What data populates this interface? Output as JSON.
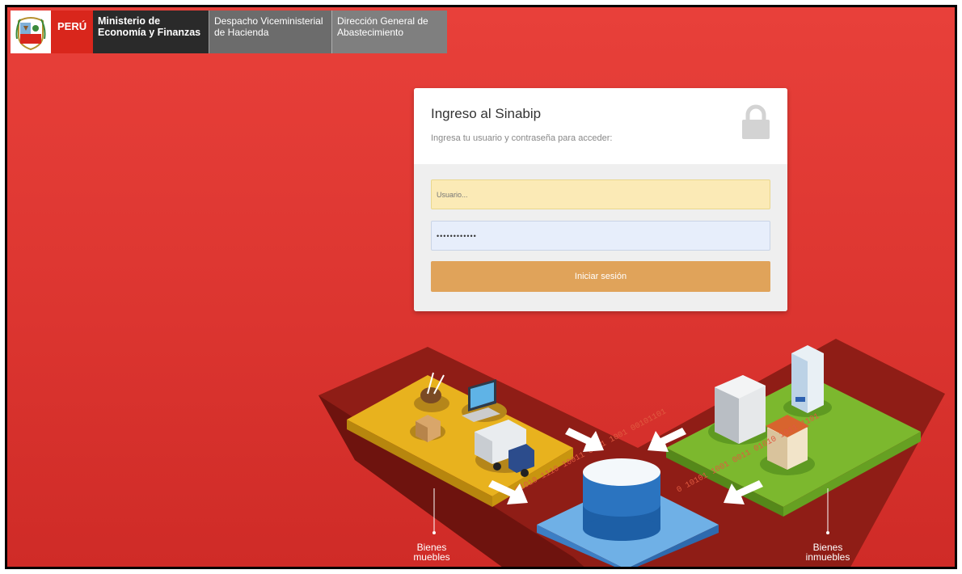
{
  "header": {
    "country": "PERÚ",
    "ministry_line1": "Ministerio de",
    "ministry_line2": "Economía y Finanzas",
    "vice_line1": "Despacho Viceministerial",
    "vice_line2": "de Hacienda",
    "dga_line1": "Dirección General de",
    "dga_line2": "Abastecimiento"
  },
  "login": {
    "title": "Ingreso al Sinabip",
    "subtitle": "Ingresa tu usuario y contraseña para acceder:",
    "username_placeholder": "Usuario...",
    "password_value": "••••••••••••",
    "submit_label": "Iniciar sesión"
  },
  "illustration": {
    "left_label_1": "Bienes",
    "left_label_2": "muebles",
    "right_label_1": "Bienes",
    "right_label_2": "inmuebles",
    "binary_text_left": "01010 1110 10011 0 01 1001 00101101",
    "binary_text_right": "0 10101 1001 0011 01010 1011 1101"
  },
  "colors": {
    "background": "#dc3530",
    "header_dark": "#2a2a2a",
    "header_gray": "#6c6c6c",
    "button": "#e0a35a",
    "username_bg": "#fbeab6",
    "password_bg": "#e7eefb"
  }
}
